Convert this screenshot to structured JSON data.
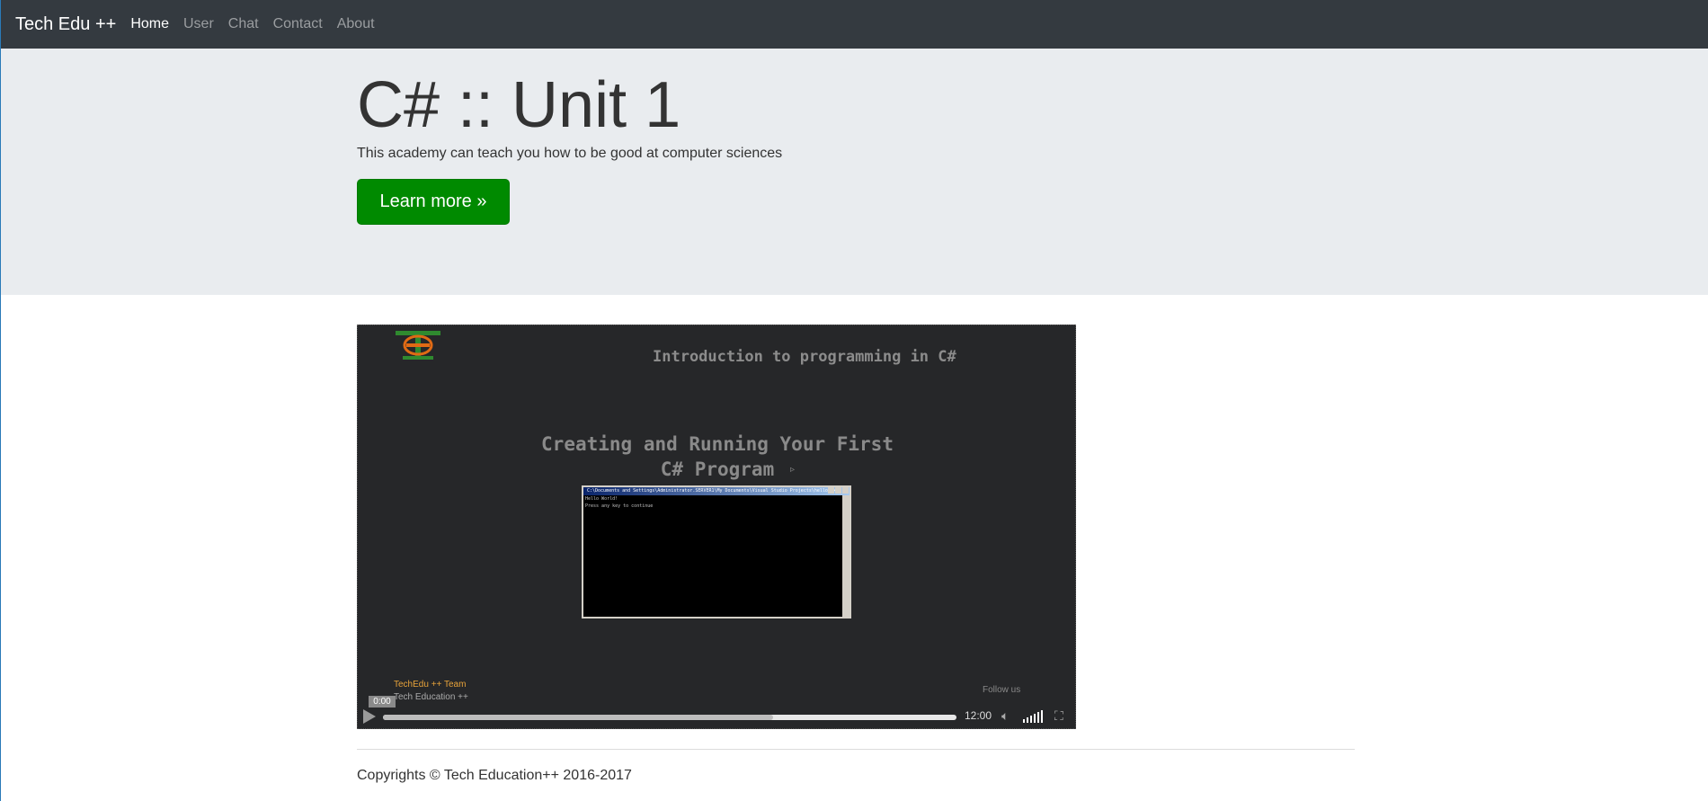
{
  "navbar": {
    "brand": "Tech Edu ++",
    "links": [
      {
        "label": "Home",
        "active": true
      },
      {
        "label": "User",
        "active": false
      },
      {
        "label": "Chat",
        "active": false
      },
      {
        "label": "Contact",
        "active": false
      },
      {
        "label": "About",
        "active": false
      }
    ]
  },
  "jumbotron": {
    "title": "C# :: Unit 1",
    "lead": "This academy can teach you how to be good at computer sciences",
    "button_label": "Learn more »"
  },
  "video": {
    "heading": "Introduction to programming in C#",
    "subheading_line1": "Creating and Running Your First",
    "subheading_line2": "C# Program",
    "console_title": "C:\\Documents and Settings\\Administrator.SERVER1\\My Documents\\Visual Studio Projects\\hello.exe",
    "console_line1": "Hello World!",
    "console_line2": "Press any key to continue",
    "team": "TechEdu ++ Team",
    "team_sub": "Tech Education ++",
    "follow": "Follow us",
    "current_time": "0:00",
    "duration": "12:00",
    "buffered_fraction": 0.68
  },
  "footer": {
    "copyright": "Copyrights © Tech Education++ 2016-2017"
  },
  "colors": {
    "navbar_bg": "#343a40",
    "jumbotron_bg": "#e9ecef",
    "button_bg": "#008a00",
    "video_bg": "#262729"
  }
}
